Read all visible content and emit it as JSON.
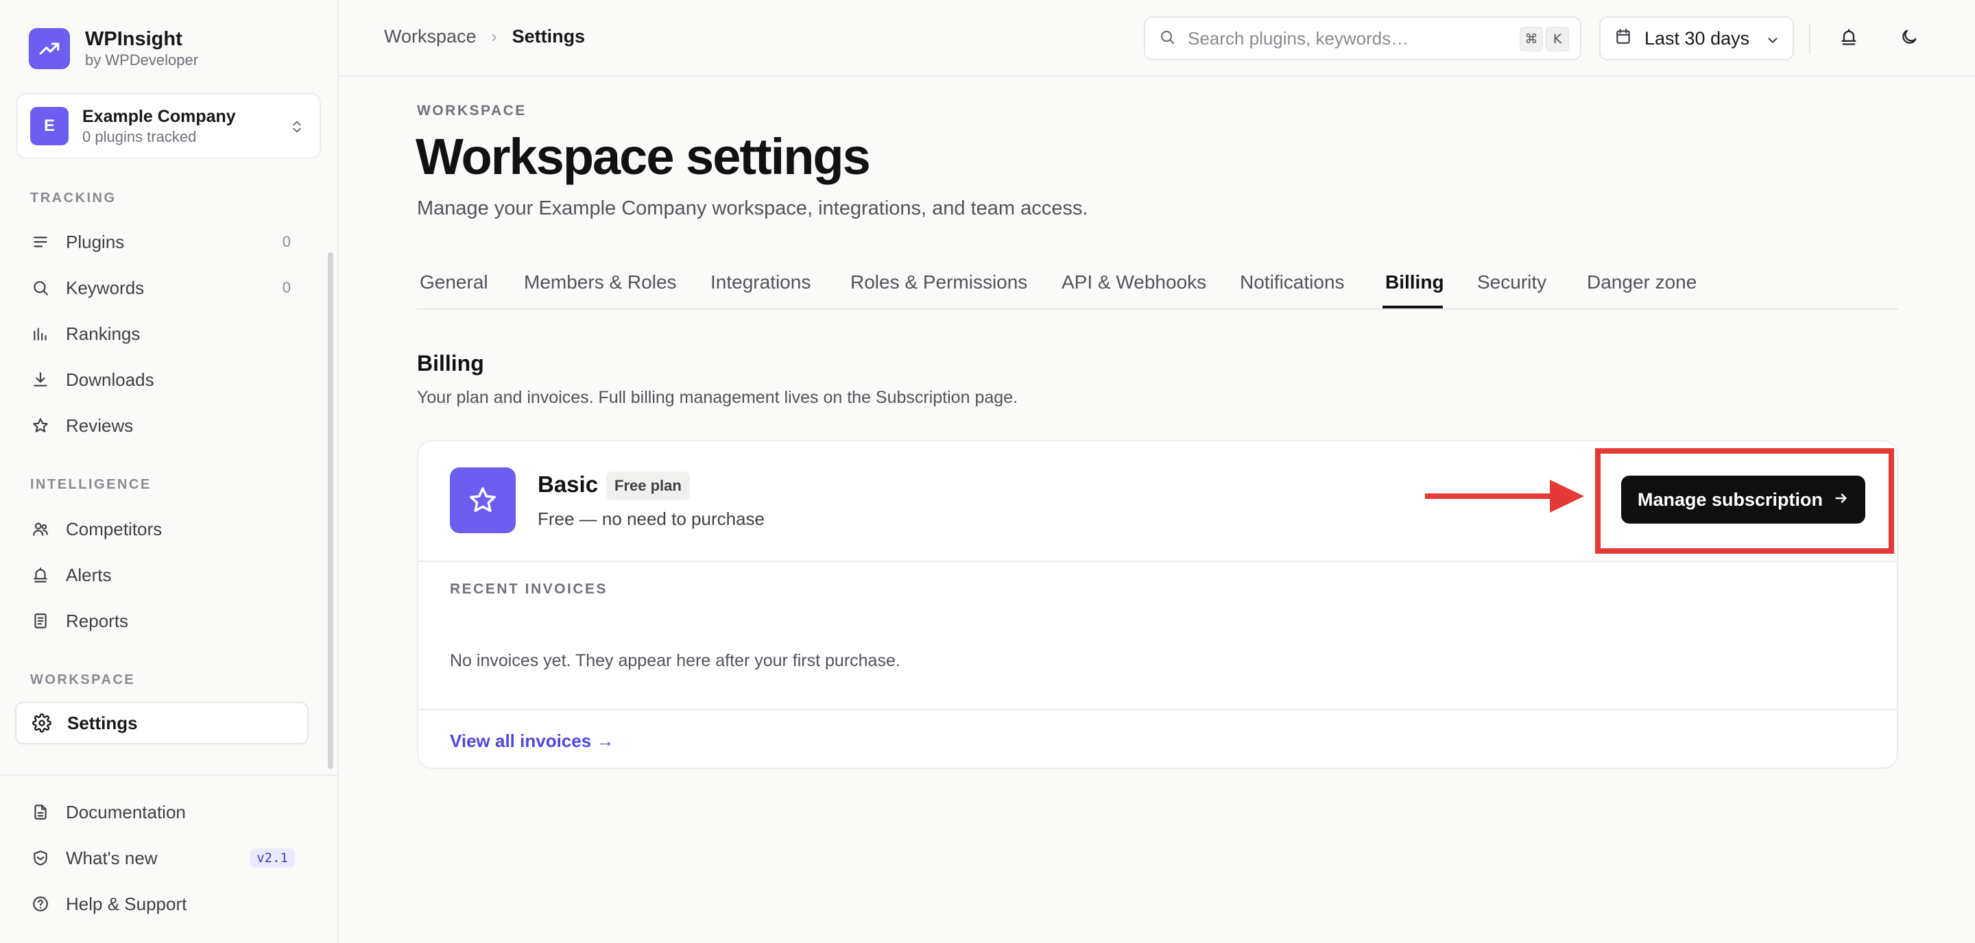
{
  "brand": {
    "name": "WPInsight",
    "sub": "by WPDeveloper"
  },
  "company": {
    "avatar": "E",
    "name": "Example Company",
    "sub": "0 plugins tracked"
  },
  "sidebar": {
    "tracking_label": "TRACKING",
    "tracking": [
      {
        "label": "Plugins",
        "count": "0",
        "icon": "list-icon"
      },
      {
        "label": "Keywords",
        "count": "0",
        "icon": "search-icon"
      },
      {
        "label": "Rankings",
        "icon": "bar-chart-icon"
      },
      {
        "label": "Downloads",
        "icon": "download-icon"
      },
      {
        "label": "Reviews",
        "icon": "star-icon"
      }
    ],
    "intelligence_label": "INTELLIGENCE",
    "intelligence": [
      {
        "label": "Competitors",
        "icon": "users-icon"
      },
      {
        "label": "Alerts",
        "icon": "bell-icon"
      },
      {
        "label": "Reports",
        "icon": "report-icon"
      }
    ],
    "workspace_label": "WORKSPACE",
    "workspace": [
      {
        "label": "Settings",
        "icon": "gear-icon"
      }
    ],
    "footer": [
      {
        "label": "Documentation",
        "icon": "document-icon"
      },
      {
        "label": "What's new",
        "icon": "shield-icon",
        "badge": "v2.1"
      },
      {
        "label": "Help & Support",
        "icon": "help-icon"
      }
    ]
  },
  "topbar": {
    "breadcrumb": [
      "Workspace",
      "Settings"
    ],
    "search_placeholder": "Search plugins, keywords…",
    "shortcut": [
      "⌘",
      "K"
    ],
    "range": "Last 30 days"
  },
  "page": {
    "eyebrow": "WORKSPACE",
    "title": "Workspace settings",
    "subtitle": "Manage your Example Company workspace, integrations, and team access."
  },
  "tabs": [
    "General",
    "Members & Roles",
    "Integrations",
    "Roles & Permissions",
    "API & Webhooks",
    "Notifications",
    "Billing",
    "Security",
    "Danger zone"
  ],
  "active_tab": "Billing",
  "billing": {
    "title": "Billing",
    "subtitle": "Your plan and invoices. Full billing management lives on the Subscription page.",
    "plan_name": "Basic",
    "plan_badge": "Free plan",
    "plan_desc": "Free — no need to purchase",
    "manage_label": "Manage subscription",
    "invoices_label": "RECENT INVOICES",
    "invoices_empty": "No invoices yet. They appear here after your first purchase.",
    "view_all": "View all invoices →"
  },
  "colors": {
    "accent": "#6d5df0",
    "annotation": "#e53935",
    "link": "#4f46e5"
  }
}
